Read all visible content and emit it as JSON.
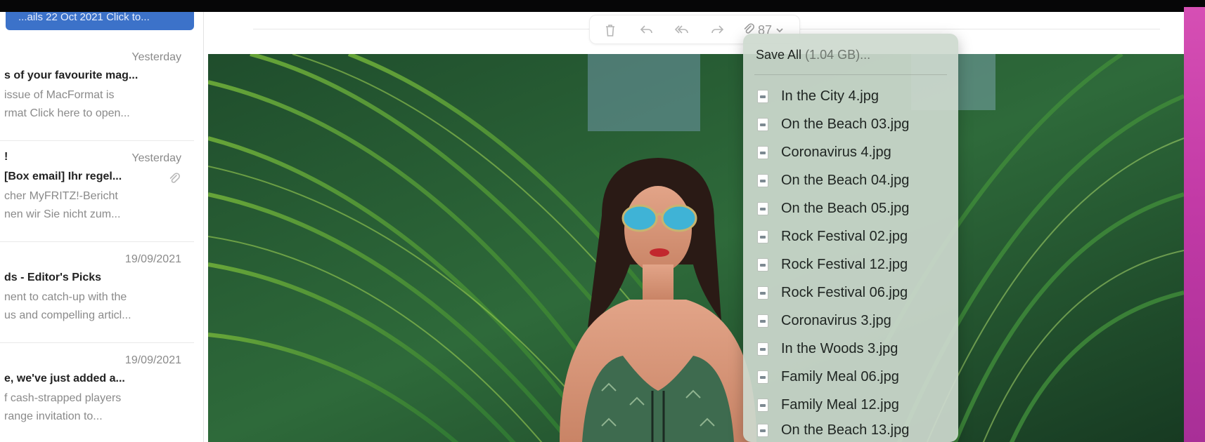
{
  "message_list": {
    "selected_snippet": "...ails 22 Oct 2021 Click to...",
    "messages": [
      {
        "date": "Yesterday",
        "subject": "s of your favourite mag...",
        "preview_line1": "issue of MacFormat is",
        "preview_line2": "rmat Click here to open...",
        "has_attachment": false
      },
      {
        "date": "Yesterday",
        "subject": "[Box email] Ihr regel...",
        "subject_prefix": "!",
        "preview_line1": "cher MyFRITZ!-Bericht",
        "preview_line2": "nen wir Sie nicht zum...",
        "has_attachment": true
      },
      {
        "date": "19/09/2021",
        "subject": "ds - Editor's Picks",
        "preview_line1": "nent to catch-up with the",
        "preview_line2": "us and compelling articl...",
        "has_attachment": false
      },
      {
        "date": "19/09/2021",
        "subject": "e, we've just added a...",
        "preview_line1": "f cash-strapped players",
        "preview_line2": "range invitation to...",
        "has_attachment": false
      }
    ]
  },
  "toolbar": {
    "attachment_count": "87",
    "icons": [
      "trash-icon",
      "reply-icon",
      "reply-all-icon",
      "forward-icon",
      "paperclip-icon",
      "chevron-down-icon"
    ]
  },
  "save_menu": {
    "save_all_label": "Save All",
    "save_all_size": "(1.04 GB)...",
    "files": [
      "In the City 4.jpg",
      "On the Beach 03.jpg",
      "Coronavirus 4.jpg",
      "On the Beach 04.jpg",
      "On the Beach 05.jpg",
      "Rock Festival 02.jpg",
      "Rock Festival 12.jpg",
      "Rock Festival 06.jpg",
      "Coronavirus 3.jpg",
      "In the Woods 3.jpg",
      "Family Meal 06.jpg",
      "Family Meal 12.jpg",
      "On the Beach 13.jpg"
    ]
  },
  "colors": {
    "selection_blue": "#3c72c9",
    "desktop_magenta": "#c23aa6",
    "menu_background": "#cdd9ce"
  }
}
